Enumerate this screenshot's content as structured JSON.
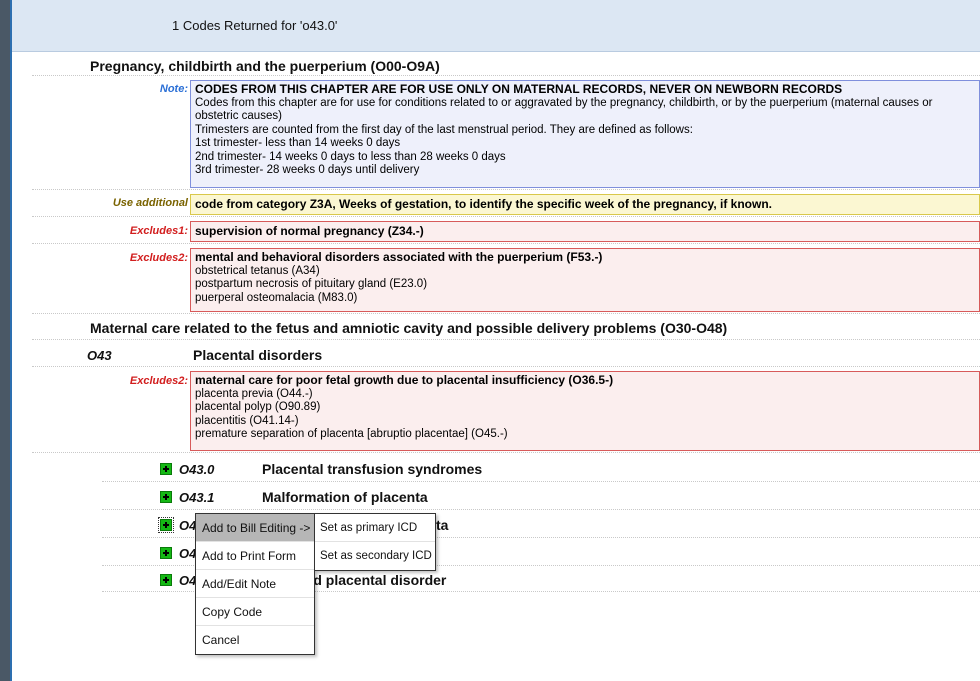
{
  "header": {
    "title": "1 Codes Returned for 'o43.0'"
  },
  "chapter": {
    "title": "Pregnancy, childbirth and the puerperium (O00-O9A)"
  },
  "note": {
    "label": "Note:",
    "lead": "CODES FROM THIS CHAPTER ARE FOR USE ONLY ON MATERNAL RECORDS, NEVER ON NEWBORN RECORDS",
    "lines": [
      "Codes from this chapter are for use for conditions related to or aggravated by the pregnancy, childbirth, or by the puerperium (maternal causes or obstetric causes)",
      "Trimesters are counted from the first day of the last menstrual period. They are defined as follows:",
      "1st trimester- less than 14 weeks 0 days",
      "2nd trimester- 14 weeks 0 days to less than 28 weeks 0 days",
      "3rd trimester- 28 weeks 0 days until delivery"
    ]
  },
  "use_additional": {
    "label": "Use additional",
    "text": "code from category Z3A, Weeks of gestation, to identify the specific week of the pregnancy, if known."
  },
  "excludes1": {
    "label": "Excludes1:",
    "text": "supervision of normal pregnancy (Z34.-)"
  },
  "excludes2_chapter": {
    "label": "Excludes2:",
    "lead": "mental and behavioral disorders associated with the puerperium (F53.-)",
    "lines": [
      "obstetrical tetanus (A34)",
      "postpartum necrosis of pituitary gland (E23.0)",
      "puerperal osteomalacia (M83.0)"
    ]
  },
  "section": {
    "title": "Maternal care related to the fetus and amniotic cavity and possible delivery problems (O30-O48)"
  },
  "category": {
    "code": "O43",
    "title": "Placental disorders"
  },
  "excludes2_category": {
    "label": "Excludes2:",
    "lead": "maternal care for poor fetal growth due to placental insufficiency (O36.5-)",
    "lines": [
      "placenta previa (O44.-)",
      "placental polyp (O90.89)",
      "placentitis (O41.14-)",
      "premature separation of placenta [abruptio placentae] (O45.-)"
    ]
  },
  "subcodes": [
    {
      "code": "O43.0",
      "title": "Placental transfusion syndromes"
    },
    {
      "code": "O43.1",
      "title": "Malformation of placenta"
    },
    {
      "code": "O4",
      "title": "ta"
    },
    {
      "code": "O4",
      "title": ""
    },
    {
      "code": "O4",
      "title": "fied placental disorder"
    }
  ],
  "context_menu": {
    "items": [
      "Add to Bill Editing ->",
      "Add to Print Form",
      "Add/Edit Note",
      "Copy Code",
      "Cancel"
    ]
  },
  "submenu": {
    "items": [
      "Set as primary ICD",
      "Set as secondary ICD"
    ]
  },
  "colors": {
    "note_label": "#2a6fd6",
    "excludes_label": "#d21e1e",
    "use_additional_label": "#7a6300",
    "plus_icon": "#14b814"
  }
}
